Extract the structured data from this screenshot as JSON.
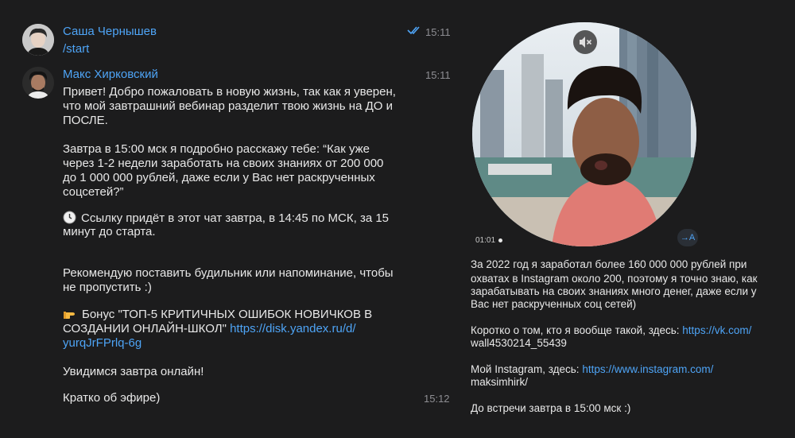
{
  "messages": [
    {
      "sender": "Саша Чернышев",
      "time": "15:11",
      "text": "/start"
    },
    {
      "sender": "Макс Хирковский",
      "time": "15:11",
      "lines": [
        "Привет! Добро пожаловать в новую жизнь, так как я уверен,",
        "что мой завтрашний вебинар разделит твою жизнь на ДО и",
        "ПОСЛЕ.",
        "Завтра в 15:00 мск я подробно расскажу тебе: “Как уже",
        "через 1-2 недели заработать на своих знаниях от 200 000",
        "до 1 000 000 рублей, даже если у Вас нет раскрученных",
        "соцсетей?”",
        "Ссылку придёт в этот чат завтра, в 14:45 по МСК, за 15",
        "минут до старта.",
        "Рекомендую поставить будильник или напоминание, чтобы",
        "не пропустить :)",
        "Бонус \"ТОП-5 КРИТИЧНЫХ ОШИБОК НОВИЧКОВ В",
        "СОЗДАНИИ ОНЛАЙН-ШКОЛ\"",
        "Увидимся завтра онлайн!"
      ],
      "bonus_link_part1": "https://disk.yandex.ru/d/",
      "bonus_link_part2": "yurqJrFPrlq-6g"
    },
    {
      "text": "Кратко об эфире)",
      "time": "15:12"
    }
  ],
  "video": {
    "duration": "01:01",
    "translate_label": "→A"
  },
  "caption": {
    "lines": [
      "За 2022 год я заработал более 160 000 000 рублей при",
      "охватах в Instagram около 200, поэтому я точно знаю, как",
      "зарабатывать на своих знаниях много денег, даже если у",
      "Вас нет раскрученных соц сетей)",
      "Коротко о том, кто я вообще такой, здесь:",
      "Мой Instagram, здесь:",
      "До встречи завтра в 15:00 мск :)"
    ],
    "vk_link_part1": "https://vk.com/",
    "vk_link_part2": "wall4530214_55439",
    "ig_link_part1": "https://www.instagram.com/",
    "ig_link_part2": "maksimhirk/"
  },
  "colors": {
    "background": "#1c1c1d",
    "accent": "#4ea4f6",
    "text": "#e8e8e8",
    "muted": "#8e8e93"
  }
}
